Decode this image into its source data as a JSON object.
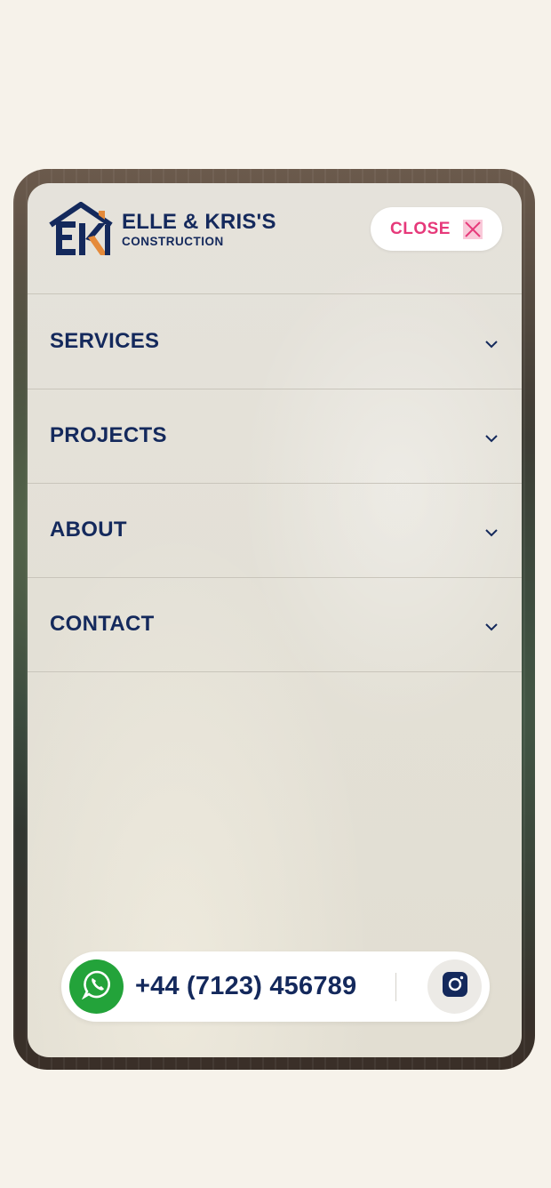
{
  "brand": {
    "name": "ELLE & KRIS'S",
    "subtitle": "CONSTRUCTION",
    "logo_icon": "house-ek-logo-icon",
    "colors": {
      "navy": "#14295c",
      "orange": "#e58a3a",
      "pink": "#e6397a"
    }
  },
  "header": {
    "close_label": "CLOSE",
    "close_icon": "close-icon"
  },
  "nav": {
    "items": [
      {
        "label": "SERVICES",
        "icon": "chevron-down-icon"
      },
      {
        "label": "PROJECTS",
        "icon": "chevron-down-icon"
      },
      {
        "label": "ABOUT",
        "icon": "chevron-down-icon"
      },
      {
        "label": "CONTACT",
        "icon": "chevron-down-icon"
      }
    ]
  },
  "contact_bar": {
    "whatsapp_icon": "whatsapp-icon",
    "whatsapp_color": "#23a33a",
    "phone": "+44 (7123) 456789",
    "instagram_icon": "instagram-icon"
  }
}
